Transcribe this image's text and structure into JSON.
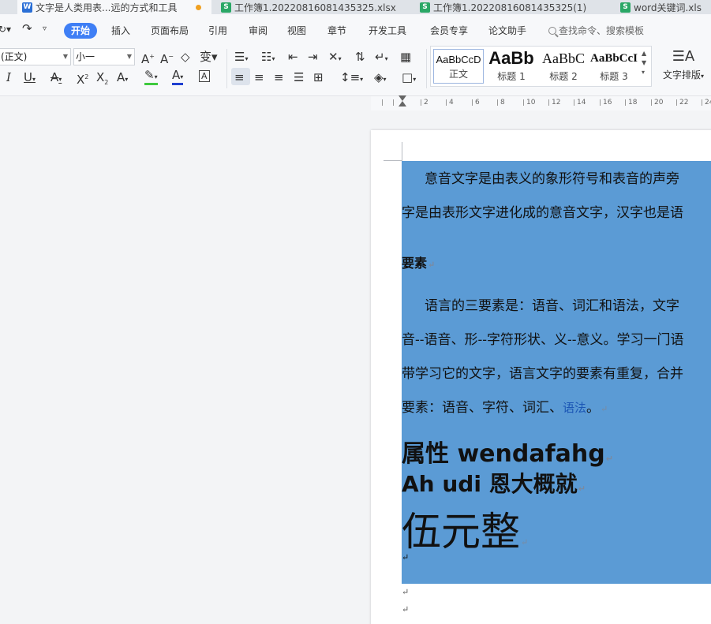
{
  "tabs": [
    {
      "label": "文字是人类用表...远的方式和工具",
      "kind": "w",
      "active": true,
      "modified": true
    },
    {
      "label": "工作簿1.20220816081435325.xlsx",
      "kind": "s",
      "active": false
    },
    {
      "label": "工作簿1.20220816081435325(1)",
      "kind": "s",
      "active": false
    },
    {
      "label": "word关键词.xls",
      "kind": "s",
      "active": false
    }
  ],
  "menu": {
    "active": "开始",
    "items": [
      "插入",
      "页面布局",
      "引用",
      "审阅",
      "视图",
      "章节",
      "开发工具",
      "会员专享",
      "论文助手"
    ],
    "search_label": "查找命令、搜索模板"
  },
  "ribbon": {
    "font_name": "(正文)",
    "font_size": "小一",
    "styles": [
      {
        "preview": "AaBbCcD",
        "label": "正文"
      },
      {
        "preview": "AaBb",
        "label": "标题 1"
      },
      {
        "preview": "AaBbC",
        "label": "标题 2"
      },
      {
        "preview": "AaBbCcI",
        "label": "标题 3"
      }
    ],
    "text_layout_label": "文字排版"
  },
  "ruler": {
    "ticks": [
      "2",
      "4",
      "6",
      "8",
      "10",
      "12",
      "14",
      "16",
      "18",
      "20",
      "22",
      "24"
    ]
  },
  "document": {
    "para1_line1": "意音文字是由表义的象形符号和表音的声旁",
    "para1_line2": "字是由表形文字进化成的意音文字，汉字也是语",
    "heading_elements": "要素",
    "para2_line1": "语言的三要素是：语音、词汇和语法，文字",
    "para2_line2": "音--语音、形--字符形状、义--意义。学习一门语",
    "para2_line3": "带学习它的文字，语言文字的要素有重复，合并",
    "para2_line4_prefix": "要素：语音、字符、词汇、",
    "para2_link": "语法",
    "para2_end": "。",
    "line_attr": "属性 wendafahg",
    "line_ah": "Ah udi 恩大概就",
    "line_big": "伍元整",
    "para_mark": "↵"
  },
  "colors": {
    "selection": "#5b9bd5",
    "accent": "#3f7ff5"
  }
}
